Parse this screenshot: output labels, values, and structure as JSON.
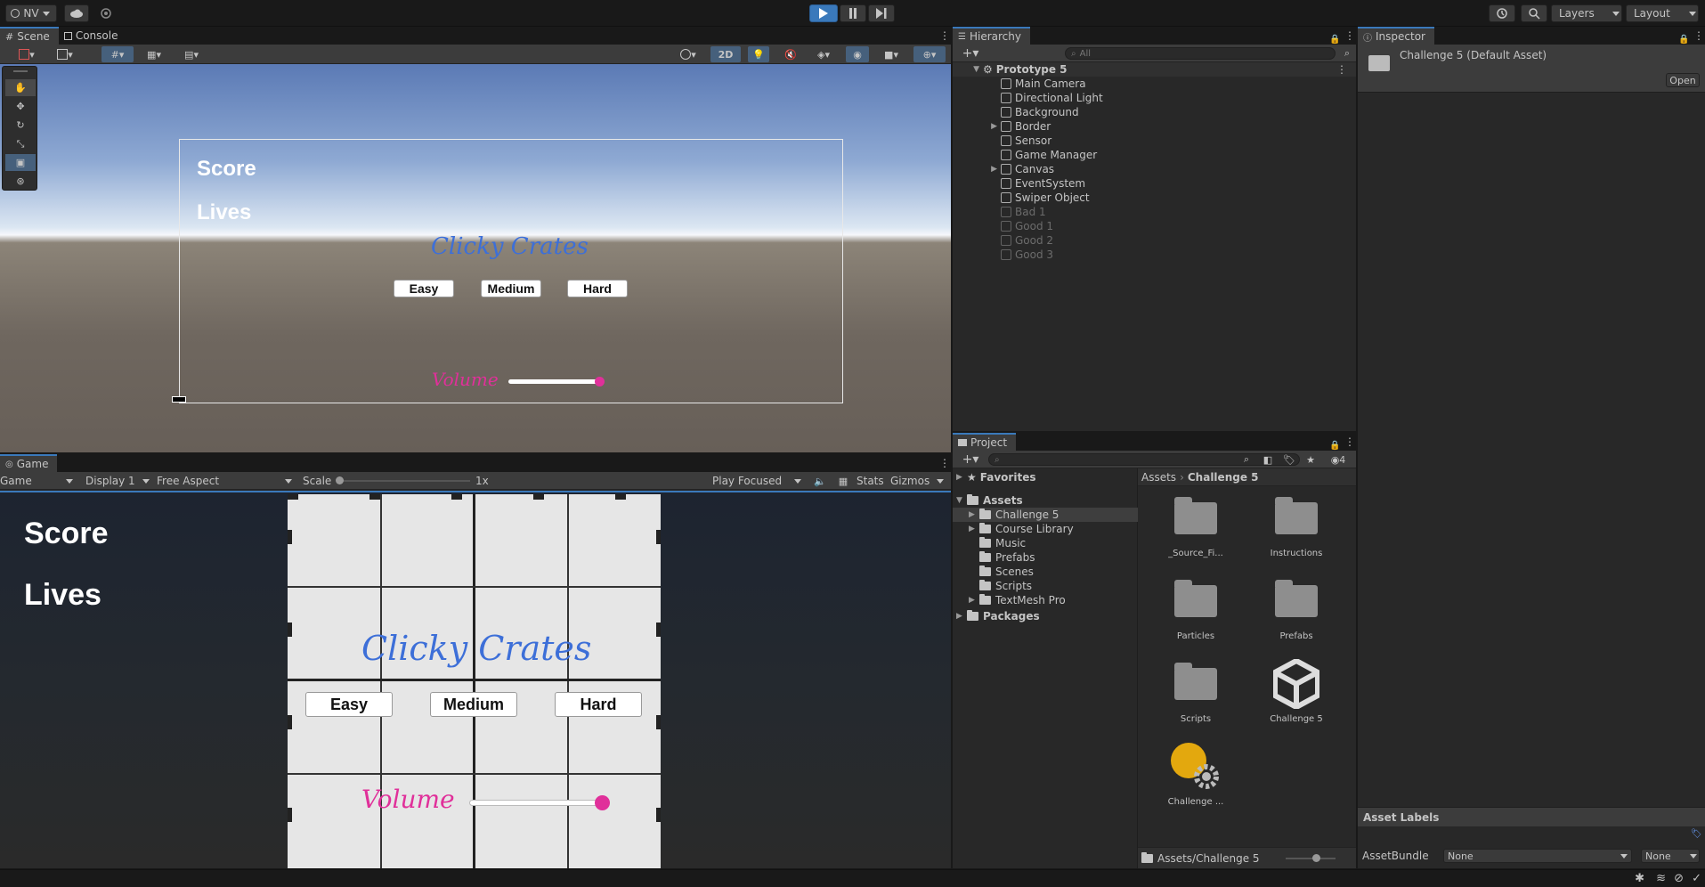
{
  "toolbar": {
    "account_label": "NV",
    "layers_label": "Layers",
    "layout_label": "Layout"
  },
  "scene": {
    "tab_scene": "Scene",
    "tab_console": "Console",
    "btn_2d": "2D",
    "ui_score": "Score",
    "ui_lives": "Lives",
    "ui_title": "Clicky Crates",
    "ui_easy": "Easy",
    "ui_medium": "Medium",
    "ui_hard": "Hard",
    "ui_volume": "Volume"
  },
  "game": {
    "tab_label": "Game",
    "view_select": "Game",
    "display_select": "Display 1",
    "aspect_select": "Free Aspect",
    "scale_label": "Scale",
    "scale_value": "1x",
    "play_focused": "Play Focused",
    "stats_label": "Stats",
    "gizmos_label": "Gizmos",
    "ui_score": "Score",
    "ui_lives": "Lives",
    "ui_title": "Clicky Crates",
    "ui_easy": "Easy",
    "ui_medium": "Medium",
    "ui_hard": "Hard",
    "ui_volume": "Volume"
  },
  "hierarchy": {
    "tab_label": "Hierarchy",
    "search_placeholder": "All",
    "root": "Prototype 5",
    "items": [
      {
        "label": "Main Camera",
        "expandable": false,
        "dim": false
      },
      {
        "label": "Directional Light",
        "expandable": false,
        "dim": false
      },
      {
        "label": "Background",
        "expandable": false,
        "dim": false
      },
      {
        "label": "Border",
        "expandable": true,
        "dim": false
      },
      {
        "label": "Sensor",
        "expandable": false,
        "dim": false
      },
      {
        "label": "Game Manager",
        "expandable": false,
        "dim": false
      },
      {
        "label": "Canvas",
        "expandable": true,
        "dim": false
      },
      {
        "label": "EventSystem",
        "expandable": false,
        "dim": false
      },
      {
        "label": "Swiper Object",
        "expandable": false,
        "dim": false
      },
      {
        "label": "Bad 1",
        "expandable": false,
        "dim": true
      },
      {
        "label": "Good 1",
        "expandable": false,
        "dim": true
      },
      {
        "label": "Good 2",
        "expandable": false,
        "dim": true
      },
      {
        "label": "Good 3",
        "expandable": false,
        "dim": true
      }
    ]
  },
  "inspector": {
    "tab_label": "Inspector",
    "asset_title": "Challenge 5 (Default Asset)",
    "open_button": "Open",
    "asset_labels": "Asset Labels",
    "assetbundle_label": "AssetBundle",
    "assetbundle_value": "None",
    "variant_value": "None"
  },
  "project": {
    "tab_label": "Project",
    "hidden_count": "4",
    "favorites": "Favorites",
    "assets": "Assets",
    "tree": [
      {
        "label": "Challenge 5",
        "expandable": true,
        "selected": true
      },
      {
        "label": "Course Library",
        "expandable": true,
        "selected": false
      },
      {
        "label": "Music",
        "expandable": false,
        "selected": false
      },
      {
        "label": "Prefabs",
        "expandable": false,
        "selected": false
      },
      {
        "label": "Scenes",
        "expandable": false,
        "selected": false
      },
      {
        "label": "Scripts",
        "expandable": false,
        "selected": false
      },
      {
        "label": "TextMesh Pro",
        "expandable": true,
        "selected": false
      }
    ],
    "packages": "Packages",
    "breadcrumb_root": "Assets",
    "breadcrumb_current": "Challenge 5",
    "assets_grid": [
      {
        "label": "_Source_Fi...",
        "kind": "folder"
      },
      {
        "label": "Instructions",
        "kind": "folder"
      },
      {
        "label": "Particles",
        "kind": "folder"
      },
      {
        "label": "Prefabs",
        "kind": "folder"
      },
      {
        "label": "Scripts",
        "kind": "folder"
      },
      {
        "label": "Challenge 5",
        "kind": "unity-scene"
      },
      {
        "label": "Challenge ...",
        "kind": "settings"
      }
    ],
    "footer_path": "Assets/Challenge 5"
  },
  "colors": {
    "accent_blue": "#3a79bb",
    "title_blue": "#3d6fd8",
    "volume_pink": "#e0309a"
  }
}
